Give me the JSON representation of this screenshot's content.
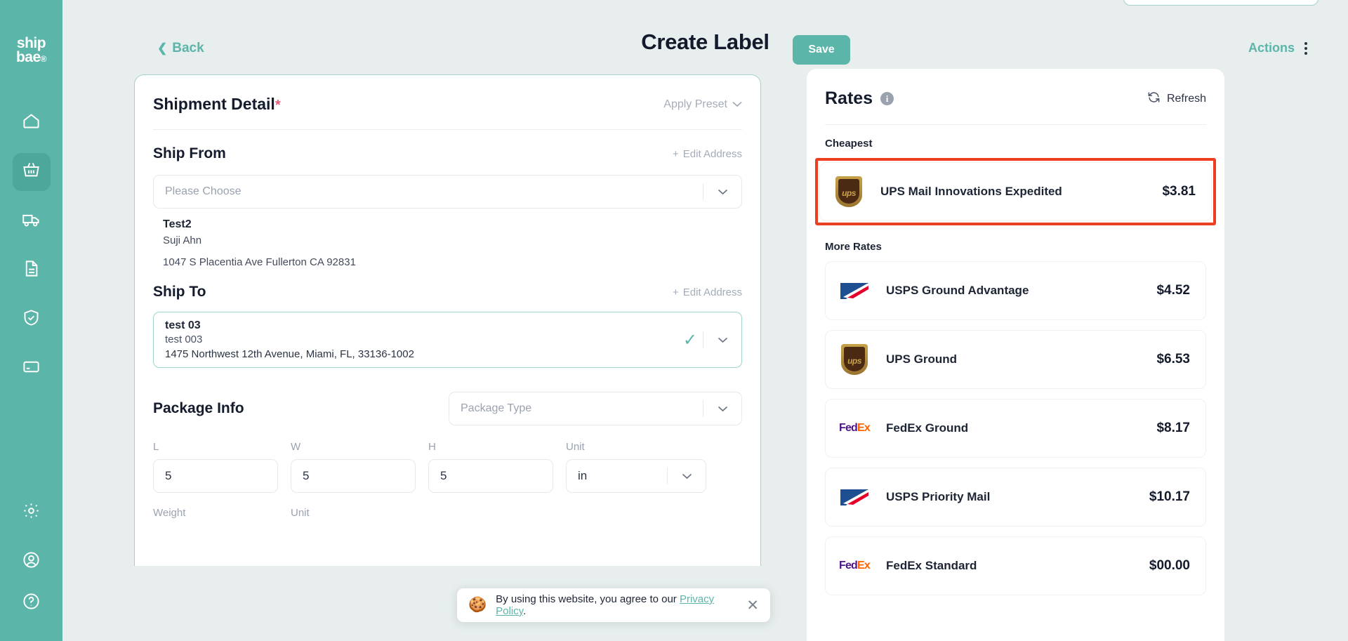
{
  "sidebar": {
    "logo_line1": "ship",
    "logo_line2": "bae",
    "logo_dot": "®",
    "items": [
      {
        "icon": "home-icon",
        "name": "home",
        "active": false
      },
      {
        "icon": "basket-icon",
        "name": "orders",
        "active": true
      },
      {
        "icon": "truck-icon",
        "name": "shipments",
        "active": false
      },
      {
        "icon": "document-icon",
        "name": "documents",
        "active": false
      },
      {
        "icon": "shield-check-icon",
        "name": "insurance",
        "active": false
      },
      {
        "icon": "credit-card-icon",
        "name": "billing",
        "active": false
      }
    ],
    "bottom_items": [
      {
        "icon": "gear-icon",
        "name": "settings"
      },
      {
        "icon": "user-circle-icon",
        "name": "account"
      },
      {
        "icon": "help-circle-icon",
        "name": "help"
      }
    ]
  },
  "header": {
    "back_label": "Back",
    "title": "Create Label",
    "save_label": "Save",
    "actions_label": "Actions"
  },
  "form": {
    "section_title": "Shipment Detail",
    "required_marker": "*",
    "apply_preset_label": "Apply Preset",
    "ship_from": {
      "title": "Ship From",
      "edit_label": "Edit Address",
      "select_placeholder": "Please Choose",
      "name": "Test2",
      "contact": "Suji Ahn",
      "street": "1047 S Placentia Ave Fullerton CA 92831"
    },
    "ship_to": {
      "title": "Ship To",
      "edit_label": "Edit Address",
      "name": "test 03",
      "contact": "test 003",
      "street": "1475 Northwest 12th Avenue, Miami, FL, 33136-1002"
    },
    "package": {
      "title": "Package Info",
      "type_placeholder": "Package Type",
      "fields": [
        {
          "label": "L",
          "value": "5"
        },
        {
          "label": "W",
          "value": "5"
        },
        {
          "label": "H",
          "value": "5"
        }
      ],
      "unit_label": "Unit",
      "unit_value": "in",
      "weight_label": "Weight",
      "weight_unit_label": "Unit"
    }
  },
  "rates": {
    "title": "Rates",
    "info_icon": "info-icon",
    "refresh_label": "Refresh",
    "cheapest_label": "Cheapest",
    "more_label": "More Rates",
    "highlight_color": "#ec3e20",
    "cheapest": [
      {
        "carrier": "ups",
        "name": "UPS Mail Innovations Expedited",
        "price": "$3.81"
      }
    ],
    "more": [
      {
        "carrier": "usps",
        "name": "USPS Ground Advantage",
        "price": "$4.52"
      },
      {
        "carrier": "ups",
        "name": "UPS Ground",
        "price": "$6.53"
      },
      {
        "carrier": "fedex",
        "name": "FedEx Ground",
        "price": "$8.17"
      },
      {
        "carrier": "usps",
        "name": "USPS Priority Mail",
        "price": "$10.17"
      },
      {
        "carrier": "fedex",
        "name": "FedEx Standard",
        "price": "$00.00"
      }
    ]
  },
  "cookie": {
    "emoji": "🍪",
    "text_before": "By using this website, you agree to our ",
    "link_label": "Privacy Policy",
    "text_after": ".",
    "close_icon": "close-icon"
  },
  "theme": {
    "accent": "#5cb5a9",
    "background": "#e7eeed",
    "text_dark": "#131b2c",
    "text_muted": "#9aa2af",
    "required": "#e35a7a",
    "highlight": "#ec3e20"
  }
}
